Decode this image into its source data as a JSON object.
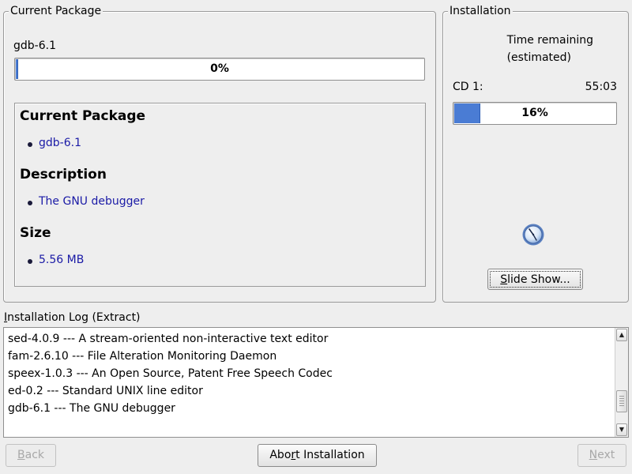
{
  "current_package": {
    "group_title": "Current Package",
    "package_name": "gdb-6.1",
    "progress_text": "0%",
    "progress_fraction": 0.0,
    "details": {
      "package_heading": "Current Package",
      "package_value": "gdb-6.1",
      "description_heading": "Description",
      "description_value": "The GNU debugger",
      "size_heading": "Size",
      "size_value": "5.56 MB"
    }
  },
  "installation": {
    "group_title": "Installation",
    "time_remaining_line1": "Time remaining",
    "time_remaining_line2": "(estimated)",
    "cd_label": "CD 1:",
    "cd_time": "55:03",
    "cd_progress_text": "16%",
    "cd_progress_fraction": 0.16,
    "clock_icon": "clock-icon",
    "slideshow_pre": "",
    "slideshow_mnemonic": "S",
    "slideshow_post": "lide Show..."
  },
  "log": {
    "label_mnemonic": "I",
    "label_rest": "nstallation Log (Extract)",
    "lines": [
      "sed-4.0.9 --- A stream-oriented non-interactive text editor",
      "fam-2.6.10 --- File Alteration Monitoring Daemon",
      "speex-1.0.3 --- An Open Source, Patent Free Speech Codec",
      "ed-0.2 --- Standard UNIX line editor",
      "gdb-6.1 --- The GNU debugger"
    ]
  },
  "buttons": {
    "back_mnemonic": "B",
    "back_rest": "ack",
    "abort_pre": "Abo",
    "abort_mnemonic": "r",
    "abort_post": "t Installation",
    "next_mnemonic": "N",
    "next_rest": "ext"
  },
  "colors": {
    "progress_fill": "#4a7cd4",
    "link_text": "#1a1aa6",
    "background": "#eeeeee"
  }
}
